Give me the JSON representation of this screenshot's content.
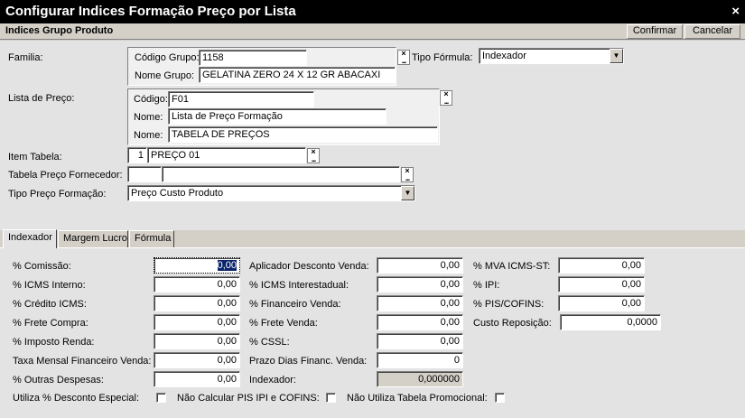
{
  "window": {
    "title": "Configurar Indices Formação Preço por Lista",
    "close": "×"
  },
  "subheader": {
    "title": "Indices Grupo Produto",
    "confirm": "Confirmar",
    "cancel": "Cancelar"
  },
  "familia": {
    "label": "Familia:",
    "codigo_label": "Código Grupo:",
    "codigo": "1158",
    "nome_label": "Nome Grupo:",
    "nome": "GELATINA ZERO 24 X 12 GR ABACAXI"
  },
  "tipo_formula": {
    "label": "Tipo Fórmula:",
    "value": "Indexador"
  },
  "lista_preco": {
    "label": "Lista de Preço:",
    "codigo_label": "Código:",
    "codigo": "F01",
    "nome1_label": "Nome:",
    "nome1": "Lista de Preço Formação",
    "nome2_label": "Nome:",
    "nome2": "TABELA DE PREÇOS"
  },
  "item_tabela": {
    "label": "Item Tabela:",
    "num": "1",
    "value": "PREÇO 01"
  },
  "tabela_fornecedor": {
    "label": "Tabela Preço Fornecedor:",
    "codigo": "",
    "nome": ""
  },
  "tipo_preco": {
    "label": "Tipo Preço Formação:",
    "value": "Preço Custo Produto"
  },
  "picker": {
    "x": "×",
    "dots": "..."
  },
  "dropdown_arrow": "▼",
  "tabs": [
    "Indexador",
    "Margem Lucro",
    "Fórmula"
  ],
  "col1": [
    {
      "label": "% Comissão:",
      "value": "0,00"
    },
    {
      "label": "% ICMS Interno:",
      "value": "0,00"
    },
    {
      "label": "% Crédito ICMS:",
      "value": "0,00"
    },
    {
      "label": "% Frete Compra:",
      "value": "0,00"
    },
    {
      "label": "% Imposto Renda:",
      "value": "0,00"
    },
    {
      "label": "Taxa Mensal Financeiro Venda:",
      "value": "0,00"
    },
    {
      "label": "% Outras Despesas:",
      "value": "0,00"
    }
  ],
  "col2": [
    {
      "label": "Aplicador Desconto Venda:",
      "value": "0,00"
    },
    {
      "label": "% ICMS Interestadual:",
      "value": "0,00"
    },
    {
      "label": "% Financeiro Venda:",
      "value": "0,00"
    },
    {
      "label": "% Frete Venda:",
      "value": "0,00"
    },
    {
      "label": "% CSSL:",
      "value": "0,00"
    },
    {
      "label": "Prazo Dias Financ. Venda:",
      "value": "0"
    },
    {
      "label": "Indexador:",
      "value": "0,000000"
    }
  ],
  "col3": [
    {
      "label": "% MVA ICMS-ST:",
      "value": "0,00"
    },
    {
      "label": "% IPI:",
      "value": "0,00"
    },
    {
      "label": "% PIS/COFINS:",
      "value": "0,00"
    },
    {
      "label": "Custo Reposição:",
      "value": "0,0000"
    }
  ],
  "checks": [
    {
      "label": "Utiliza % Desconto Especial:"
    },
    {
      "label": "Não Calcular PIS IPI e COFINS:"
    },
    {
      "label": "Não Utiliza Tabela Promocional:"
    }
  ]
}
